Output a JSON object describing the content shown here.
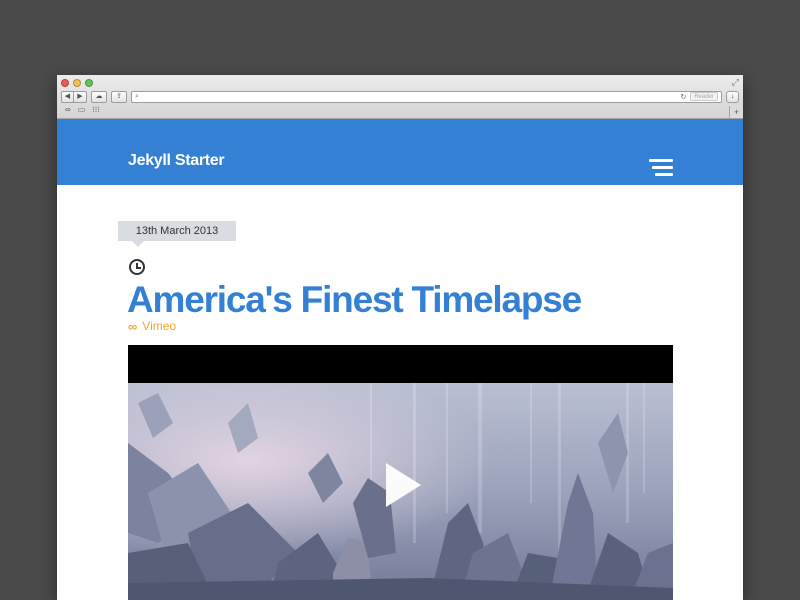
{
  "browser": {
    "url_text": "",
    "reader_label": "Reader",
    "toolbar_icons": [
      "back-icon",
      "forward-icon",
      "cloud-icon",
      "share-icon",
      "search-icon",
      "reload-icon",
      "download-icon"
    ],
    "bookmark_icons": [
      "reading-list-icon",
      "bookmarks-icon",
      "top-sites-icon"
    ],
    "new_tab_label": "+"
  },
  "site": {
    "title": "Jekyll Starter",
    "menu_icon": "hamburger-icon",
    "accent_color": "#3380d4"
  },
  "post": {
    "date": "13th March 2013",
    "date_icon": "clock-icon",
    "title": "America's Finest Timelapse",
    "source_label": "Vimeo",
    "source_icon": "link-icon",
    "source_color": "#f2a52d",
    "video_play_icon": "play-icon"
  }
}
